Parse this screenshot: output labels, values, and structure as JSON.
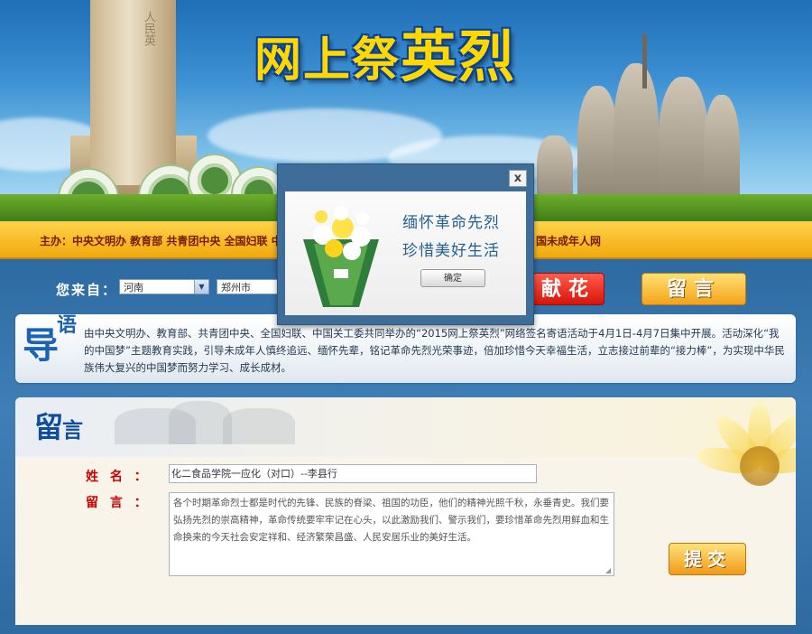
{
  "banner": {
    "title_part1": "网上祭",
    "title_part2": "英烈",
    "monument_carving": "人民英"
  },
  "sponsor": {
    "text": "主办：中央文明办 教育部 共青团中央 全国妇联 中",
    "tail": "国未成年人网"
  },
  "origin": {
    "label": "您来自：",
    "province": "河南",
    "city": "郑州市"
  },
  "actions": {
    "flower_label": "献花",
    "message_label": "留言"
  },
  "intro": {
    "icon_big": "导",
    "icon_small": "语",
    "text": "由中央文明办、教育部、共青团中央、全国妇联、中国关工委共同举办的“2015网上祭英烈”网络签名寄语活动于4月1日-4月7日集中开展。活动深化“我的中国梦”主题教育实践，引导未成年人慎终追远、缅怀先辈，铭记革命先烈光荣事迹，倍加珍惜今天幸福生活，立志接过前辈的“接力棒”，为实现中华民族伟大复兴的中国梦而努力学习、成长成材。"
  },
  "message_section": {
    "title_big": "留",
    "title_small": "言",
    "name_label": "姓 名 ：",
    "message_label": "留 言 ：",
    "name_value": "化二食品学院一应化（对口）--李县行",
    "message_value": "各个时期革命烈士都是时代的先锋、民族的脊梁、祖国的功臣，他们的精神光照千秋，永垂青史。我们要弘扬先烈的崇高精神，革命传统要牢牢记在心头，以此激励我们、警示我们，要珍惜革命先烈用鲜血和生命换来的今天社会安定祥和、经济繁荣昌盛、人民安居乐业的美好生活。",
    "submit_label": "提交"
  },
  "modal": {
    "close_label": "x",
    "line1": "缅怀革命先烈",
    "line2": "珍惜美好生活",
    "confirm_label": "确定"
  },
  "colors": {
    "sponsor_bar": "#f2a90e",
    "body_blue": "#3f7fb6",
    "label_red": "#cc0000",
    "title_blue": "#0d4d9f",
    "flower_red": "#d8140a",
    "gold_button": "#f4a31b"
  }
}
